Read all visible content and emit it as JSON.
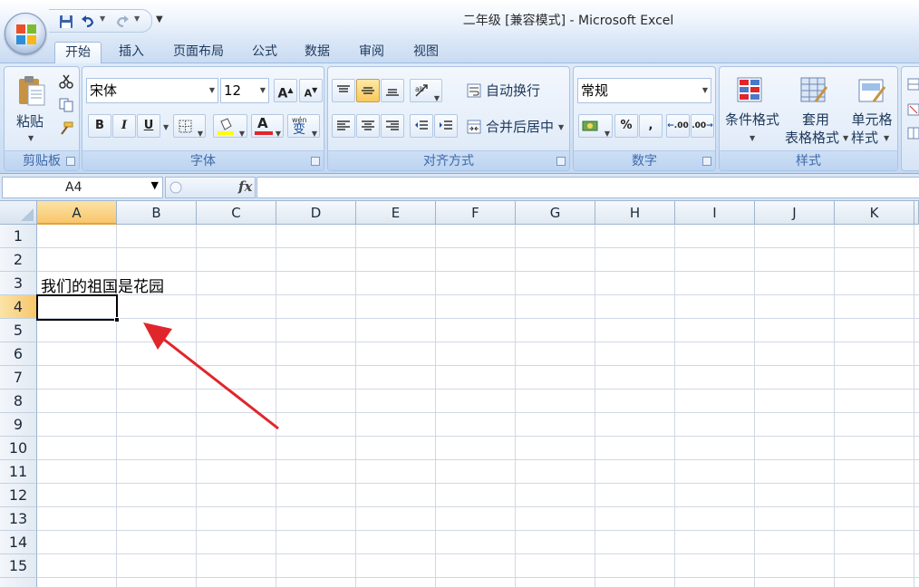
{
  "window": {
    "title": "二年级  [兼容模式] - Microsoft Excel"
  },
  "ribbon_tabs": [
    "开始",
    "插入",
    "页面布局",
    "公式",
    "数据",
    "审阅",
    "视图"
  ],
  "active_tab": "开始",
  "groups": {
    "clipboard": {
      "label": "剪贴板",
      "paste": "粘贴"
    },
    "font": {
      "label": "字体",
      "font_name": "宋体",
      "font_size": "12",
      "bold": "B",
      "italic": "I",
      "underline": "U",
      "grow": "A",
      "shrink": "A",
      "font_color_letter": "A",
      "phonetic_top": "wén",
      "phonetic_char": "变"
    },
    "alignment": {
      "label": "对齐方式",
      "wrap_text": "自动换行",
      "merge_center": "合并后居中"
    },
    "number": {
      "label": "数字",
      "format": "常规",
      "percent": "%",
      "comma": ",",
      "inc_decimal": ".00",
      "dec_decimal": ".00"
    },
    "styles": {
      "label": "样式",
      "conditional": "条件格式",
      "table_format_1": "套用",
      "table_format_2": "表格格式",
      "cell_styles_1": "单元格",
      "cell_styles_2": "样式"
    }
  },
  "formula_bar": {
    "name_box": "A4",
    "fx": "fx",
    "formula": ""
  },
  "columns": [
    "A",
    "B",
    "C",
    "D",
    "E",
    "F",
    "G",
    "H",
    "I",
    "J",
    "K"
  ],
  "rows": [
    "1",
    "2",
    "3",
    "4",
    "5",
    "6",
    "7",
    "8",
    "9",
    "10",
    "11",
    "12",
    "13",
    "14",
    "15"
  ],
  "active_cell": "A4",
  "cells": {
    "A3": "我们的祖国是花园"
  },
  "annotation": {
    "arrow_color": "#e0262b"
  },
  "colors": {
    "ribbon": "#dfeaf8",
    "accent_selected": "#f8c66b",
    "gridline": "#d0d7e5"
  }
}
